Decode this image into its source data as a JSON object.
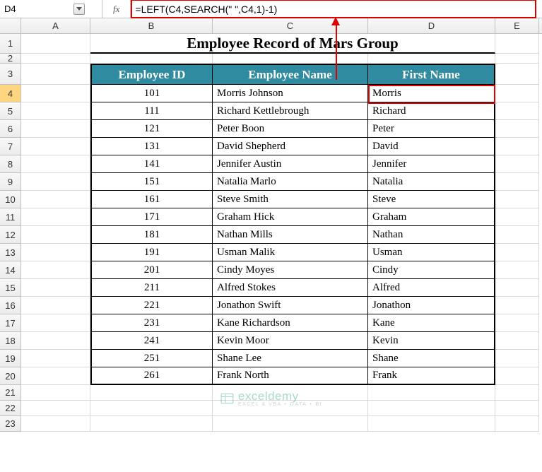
{
  "nameBox": "D4",
  "formula": "=LEFT(C4,SEARCH(\" \",C4,1)-1)",
  "title": "Employee Record of Mars Group",
  "columns": [
    "A",
    "B",
    "C",
    "D",
    "E"
  ],
  "rowNumbers": [
    "1",
    "2",
    "3",
    "4",
    "5",
    "6",
    "7",
    "8",
    "9",
    "10",
    "11",
    "12",
    "13",
    "14",
    "15",
    "16",
    "17",
    "18",
    "19",
    "20",
    "21",
    "22",
    "23"
  ],
  "headers": {
    "id": "Employee ID",
    "name": "Employee Name",
    "first": "First Name"
  },
  "rows": [
    {
      "id": "101",
      "name": "Morris Johnson",
      "first": "Morris"
    },
    {
      "id": "111",
      "name": "Richard Kettlebrough",
      "first": "Richard"
    },
    {
      "id": "121",
      "name": "Peter Boon",
      "first": "Peter"
    },
    {
      "id": "131",
      "name": "David Shepherd",
      "first": "David"
    },
    {
      "id": "141",
      "name": "Jennifer Austin",
      "first": "Jennifer"
    },
    {
      "id": "151",
      "name": "Natalia Marlo",
      "first": "Natalia"
    },
    {
      "id": "161",
      "name": "Steve Smith",
      "first": "Steve"
    },
    {
      "id": "171",
      "name": "Graham Hick",
      "first": "Graham"
    },
    {
      "id": "181",
      "name": "Nathan Mills",
      "first": "Nathan"
    },
    {
      "id": "191",
      "name": "Usman Malik",
      "first": "Usman"
    },
    {
      "id": "201",
      "name": "Cindy Moyes",
      "first": "Cindy"
    },
    {
      "id": "211",
      "name": "Alfred Stokes",
      "first": "Alfred"
    },
    {
      "id": "221",
      "name": "Jonathon Swift",
      "first": "Jonathon"
    },
    {
      "id": "231",
      "name": "Kane Richardson",
      "first": "Kane"
    },
    {
      "id": "241",
      "name": "Kevin Moor",
      "first": "Kevin"
    },
    {
      "id": "251",
      "name": "Shane Lee",
      "first": "Shane"
    },
    {
      "id": "261",
      "name": "Frank North",
      "first": "Frank"
    }
  ],
  "watermark": {
    "brand": "exceldemy",
    "tagline": "EXCEL & VBA + DATA + BI"
  }
}
